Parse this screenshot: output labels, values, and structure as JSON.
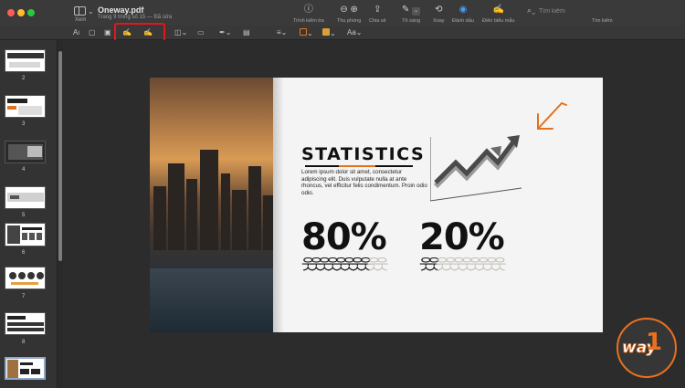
{
  "window": {
    "document_title": "Oneway.pdf",
    "document_subtitle": "Trang 9 trong số 15 — Đã sửa",
    "view_label": "Xem"
  },
  "toolbar": {
    "items": [
      {
        "label": "Trình kiểm tra",
        "icon": "info-icon"
      },
      {
        "label": "Thu phóng",
        "icon": "zoom-icon"
      },
      {
        "label": "Chia sẻ",
        "icon": "share-icon"
      },
      {
        "label": "Tô sáng",
        "icon": "highlight-icon"
      },
      {
        "label": "Xoay",
        "icon": "rotate-icon"
      },
      {
        "label": "Đánh dấu",
        "icon": "markup-icon"
      },
      {
        "label": "Điền biểu mẫu",
        "icon": "form-fill-icon"
      }
    ],
    "search_placeholder": "Tìm kiếm",
    "search_label": "Tìm kiếm"
  },
  "markup_toolbar": {
    "text_tool": "A",
    "font_tool": "Aa",
    "accent_color": "#e8141c",
    "highlight_selected": true
  },
  "sidebar": {
    "thumbnails": [
      {
        "page": "2"
      },
      {
        "page": "3"
      },
      {
        "page": "4"
      },
      {
        "page": "5"
      },
      {
        "page": "6"
      },
      {
        "page": "7"
      },
      {
        "page": "8"
      },
      {
        "page": "9",
        "active": true
      }
    ]
  },
  "slide": {
    "title": "STATISTICS",
    "body": "Lorem ipsum dolor sit amet, consectetur adipiscing elit. Duis vulputate nulla at ante rhoncus, vel efficitur felis condimentum. Proin odio odio.",
    "stats": [
      {
        "value": "80%",
        "filled": 8,
        "total": 10
      },
      {
        "value": "20%",
        "filled": 2,
        "total": 10
      }
    ],
    "accent_color": "#e2731e"
  },
  "logo": {
    "text": "way",
    "numeral": "1",
    "color": "#e8701f"
  }
}
